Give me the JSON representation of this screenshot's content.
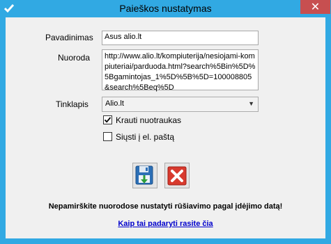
{
  "window": {
    "title": "Paieškos nustatymas",
    "close_label": "✕"
  },
  "form": {
    "name_label": "Pavadinimas",
    "name_value": "Asus alio.lt",
    "url_label": "Nuoroda",
    "url_value": "http://www.alio.lt/kompiuterija/nesiojami-kompiuteriai/parduoda.html?search%5Bin%5D%5Bgamintojas_1%5D%5B%5D=100008805&search%5Beq%5D",
    "site_label": "Tinklapis",
    "site_value": "Alio.lt",
    "load_photos_label": "Krauti nuotraukas",
    "load_photos_checked": true,
    "send_email_label": "Siųsti į el. paštą",
    "send_email_checked": false
  },
  "buttons": {
    "save_icon": "save-icon",
    "cancel_icon": "cancel-icon"
  },
  "footer": {
    "notice": "Nepamirškite nuorodose nustatyti rūšiavimo pagal įdėjimo datą!",
    "help_link": "Kaip tai padaryti rasite čia"
  },
  "colors": {
    "titlebar": "#31a9e3",
    "close_button": "#c74f50",
    "link": "#0000cc"
  }
}
